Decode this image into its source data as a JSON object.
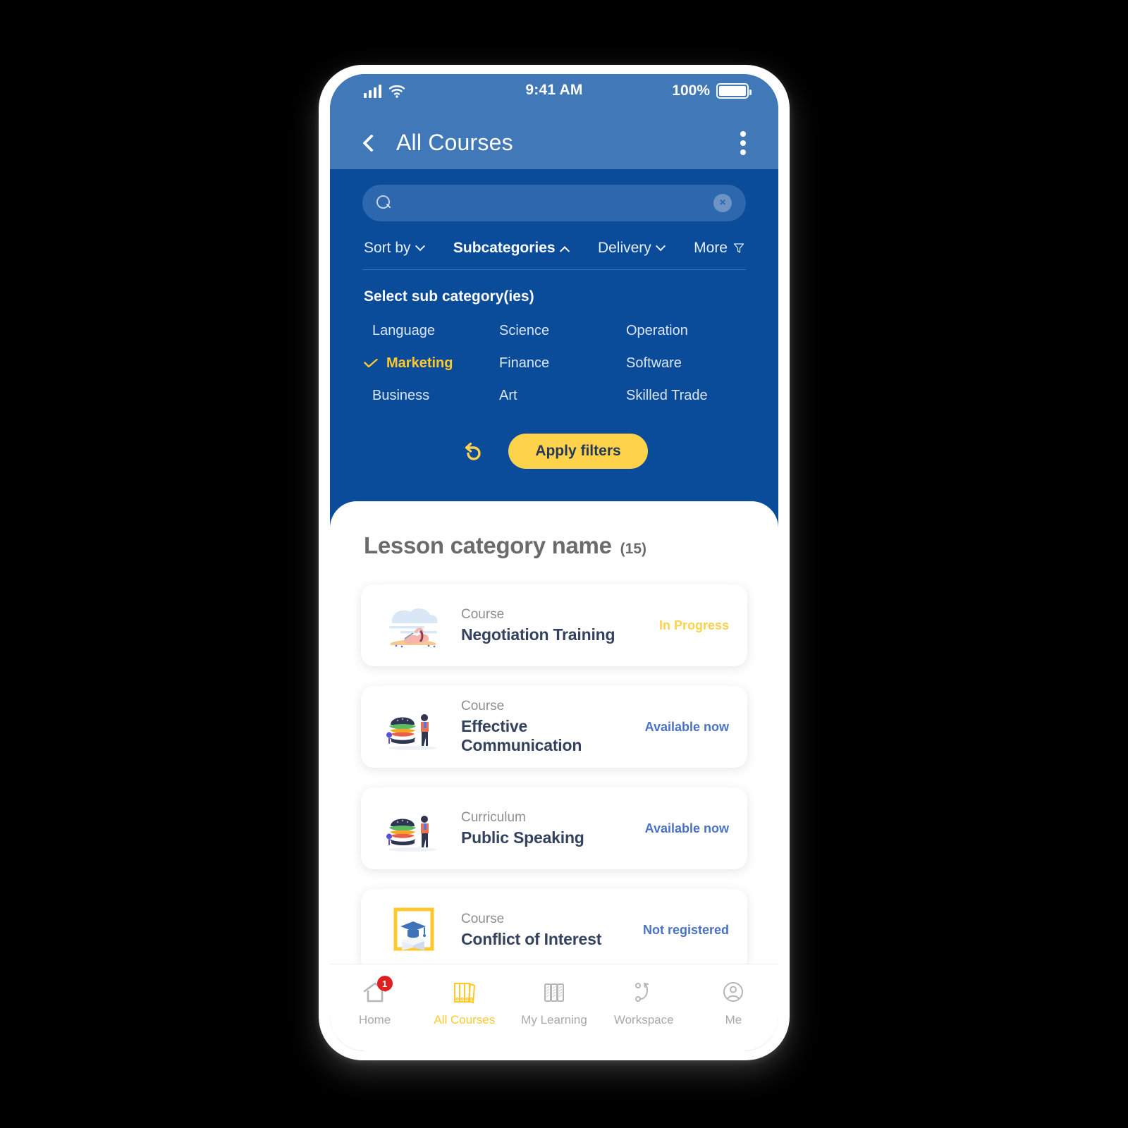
{
  "status_bar": {
    "time": "9:41 AM",
    "battery_percent": "100%",
    "signal_icon": "signal-bars-icon",
    "wifi_icon": "wifi-icon",
    "battery_icon": "battery-full-icon"
  },
  "app_bar": {
    "title": "All Courses",
    "back_icon": "back-chevron-icon",
    "menu_icon": "kebab-menu-icon"
  },
  "search": {
    "value": "",
    "placeholder": "",
    "search_icon": "search-icon",
    "clear_icon": "clear-circle-icon",
    "clear_glyph": "×"
  },
  "filter_tabs": [
    {
      "label": "Sort by",
      "active": false,
      "indicator": "chevron-down-icon"
    },
    {
      "label": "Subcategories",
      "active": true,
      "indicator": "chevron-up-icon"
    },
    {
      "label": "Delivery",
      "active": false,
      "indicator": "chevron-down-icon"
    },
    {
      "label": "More",
      "active": false,
      "indicator": "funnel-icon"
    }
  ],
  "subcategory_panel": {
    "title": "Select sub category(ies)",
    "items": [
      {
        "label": "Language",
        "selected": false
      },
      {
        "label": "Science",
        "selected": false
      },
      {
        "label": "Operation",
        "selected": false
      },
      {
        "label": "Marketing",
        "selected": true
      },
      {
        "label": "Finance",
        "selected": false
      },
      {
        "label": "Software",
        "selected": false
      },
      {
        "label": "Business",
        "selected": false
      },
      {
        "label": "Art",
        "selected": false
      },
      {
        "label": "Skilled Trade",
        "selected": false
      }
    ],
    "reset_icon": "reset-undo-icon",
    "apply_label": "Apply filters"
  },
  "section": {
    "title": "Lesson category name",
    "count": "(15)"
  },
  "courses": [
    {
      "kind": "Course",
      "name": "Negotiation Training",
      "status": "In Progress",
      "status_style": "st-progress",
      "thumb": "beach-surf-illustration"
    },
    {
      "kind": "Course",
      "name": "Effective Communication",
      "status": "Available now",
      "status_style": "st-available",
      "thumb": "burger-person-illustration"
    },
    {
      "kind": "Curriculum",
      "name": "Public Speaking",
      "status": "Available now",
      "status_style": "st-available",
      "thumb": "burger-person-illustration"
    },
    {
      "kind": "Course",
      "name": "Conflict of Interest",
      "status": "Not registered",
      "status_style": "st-notreg",
      "thumb": "graduation-cap-book-icon"
    }
  ],
  "bottom_nav": [
    {
      "label": "Home",
      "icon": "home-icon",
      "active": false,
      "badge": "1"
    },
    {
      "label": "All Courses",
      "icon": "binders-icon",
      "active": true,
      "badge": ""
    },
    {
      "label": "My Learning",
      "icon": "books-icon",
      "active": false,
      "badge": ""
    },
    {
      "label": "Workspace",
      "icon": "workspace-icon",
      "active": false,
      "badge": ""
    },
    {
      "label": "Me",
      "icon": "person-circle-icon",
      "active": false,
      "badge": ""
    }
  ],
  "colors": {
    "header_blue": "#4178b8",
    "panel_blue": "#0a4b9a",
    "accent_yellow": "#FFD24C",
    "active_yellow": "#FFC92E",
    "link_blue": "#4a72c4",
    "badge_red": "#e02020"
  }
}
